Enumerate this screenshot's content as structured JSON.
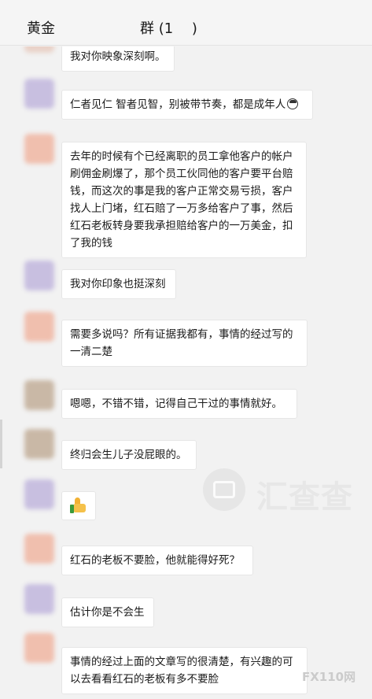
{
  "header": {
    "title_left": "黄金",
    "title_right": "群 (1　 )"
  },
  "messages": [
    {
      "text": "我对你映象深刻啊。",
      "avatar_color": "#e9d2c8"
    },
    {
      "text": "仁者见仁 智者见智，别被带节奏，都是成年人",
      "avatar_color": "#c8bfe0",
      "emoji": "face-icon"
    },
    {
      "text": "去年的时候有个已经离职的员工拿他客户的帐户刷佣金刷爆了，那个员工伙同他的客户要平台赔钱，而这次的事是我的客户正常交易亏损，客户找人上门堵，红石赔了一万多给客户了事，然后红石老板转身要我承担赔给客户的一万美金，扣了我的钱",
      "avatar_color": "#f0bfae"
    },
    {
      "text": "我对你印象也挺深刻",
      "avatar_color": "#c8bfe0"
    },
    {
      "text": "需要多说吗？所有证据我都有，事情的经过写的一清二楚",
      "avatar_color": "#f0bfae"
    },
    {
      "text": "嗯嗯，不错不错，记得自己干过的事情就好。",
      "avatar_color": "#c9b8a6"
    },
    {
      "text": "终归会生儿子没屁眼的。",
      "avatar_color": "#c9b8a6"
    },
    {
      "text": "",
      "avatar_color": "#c8bfe0",
      "emoji": "thumbs-up-icon"
    },
    {
      "text": "红石的老板不要脸，他就能得好死？",
      "avatar_color": "#f0bfae"
    },
    {
      "text": "估计你是不会生",
      "avatar_color": "#c8bfe0"
    },
    {
      "text": "事情的经过上面的文章写的很清楚，有兴趣的可以去看看红石的老板有多不要脸",
      "avatar_color": "#f0bfae"
    }
  ],
  "watermark": {
    "text": "汇查查"
  },
  "badge": {
    "text": "FX110网"
  }
}
